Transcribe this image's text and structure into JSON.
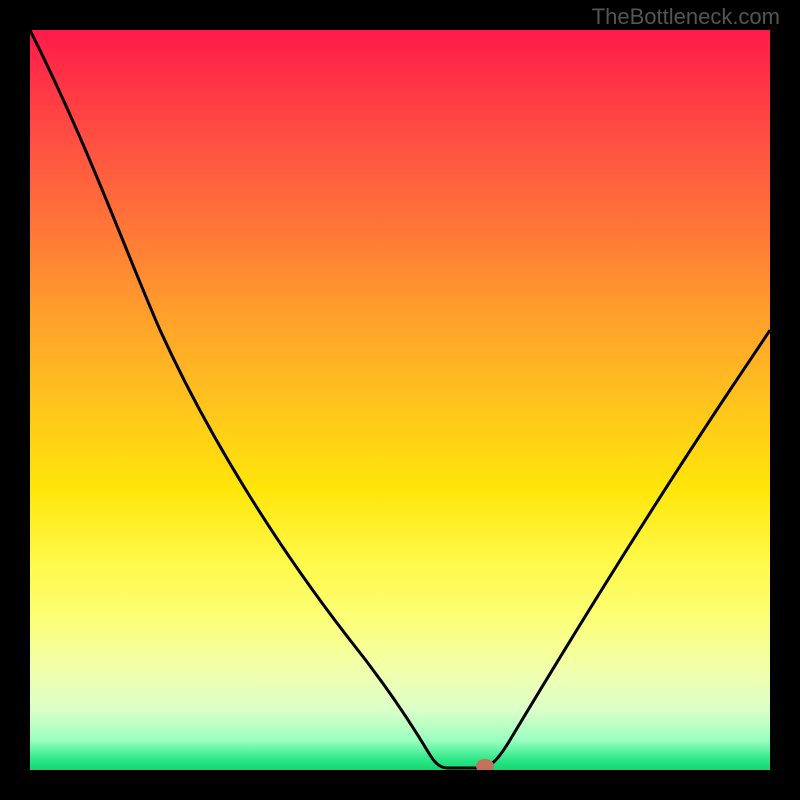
{
  "watermark": "TheBottleneck.com",
  "chart_data": {
    "type": "line",
    "title": "",
    "xlabel": "",
    "ylabel": "",
    "xlim": [
      0,
      100
    ],
    "ylim": [
      0,
      100
    ],
    "grid": false,
    "series": [
      {
        "name": "bottleneck-curve",
        "x": [
          0,
          5,
          10,
          15,
          20,
          25,
          30,
          35,
          40,
          45,
          50,
          53,
          55,
          58,
          60,
          65,
          70,
          75,
          80,
          85,
          90,
          95,
          100
        ],
        "values": [
          100,
          93,
          86,
          79,
          72,
          65,
          57,
          49,
          40,
          30,
          18,
          8,
          1,
          0,
          0,
          6,
          15,
          25,
          35,
          45,
          55,
          65,
          65
        ]
      }
    ],
    "marker": {
      "x": 60,
      "y": 0,
      "color": "#c3705c"
    },
    "gradient_stops": [
      {
        "at": 0,
        "color": "#ff1a4a"
      },
      {
        "at": 50,
        "color": "#ffc21e"
      },
      {
        "at": 80,
        "color": "#fbff7a"
      },
      {
        "at": 100,
        "color": "#14d670"
      }
    ]
  }
}
